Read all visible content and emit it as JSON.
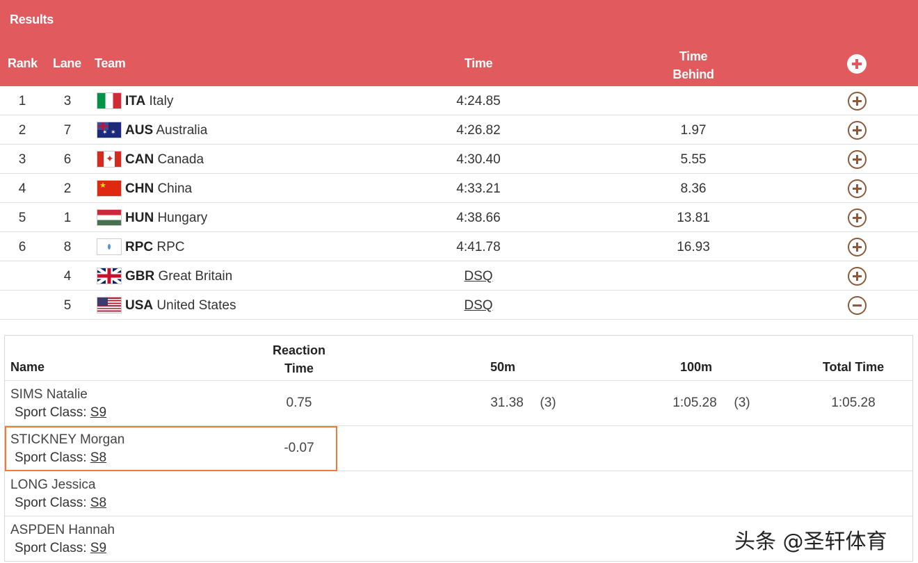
{
  "header": {
    "title": "Results",
    "columns": {
      "rank": "Rank",
      "lane": "Lane",
      "team": "Team",
      "time": "Time",
      "time_behind": "Time Behind"
    },
    "expand_all_icon": "plus-circle-filled-icon"
  },
  "results": [
    {
      "rank": "1",
      "lane": "3",
      "code": "ITA",
      "country": "Italy",
      "flag": "italy-flag-icon",
      "time": "4:24.85",
      "behind": "",
      "toggle": "plus"
    },
    {
      "rank": "2",
      "lane": "7",
      "code": "AUS",
      "country": "Australia",
      "flag": "australia-flag-icon",
      "time": "4:26.82",
      "behind": "1.97",
      "toggle": "plus"
    },
    {
      "rank": "3",
      "lane": "6",
      "code": "CAN",
      "country": "Canada",
      "flag": "canada-flag-icon",
      "time": "4:30.40",
      "behind": "5.55",
      "toggle": "plus"
    },
    {
      "rank": "4",
      "lane": "2",
      "code": "CHN",
      "country": "China",
      "flag": "china-flag-icon",
      "time": "4:33.21",
      "behind": "8.36",
      "toggle": "plus"
    },
    {
      "rank": "5",
      "lane": "1",
      "code": "HUN",
      "country": "Hungary",
      "flag": "hungary-flag-icon",
      "time": "4:38.66",
      "behind": "13.81",
      "toggle": "plus"
    },
    {
      "rank": "6",
      "lane": "8",
      "code": "RPC",
      "country": "RPC",
      "flag": "rpc-flag-icon",
      "time": "4:41.78",
      "behind": "16.93",
      "toggle": "plus"
    },
    {
      "rank": "",
      "lane": "4",
      "code": "GBR",
      "country": "Great Britain",
      "flag": "gbr-flag-icon",
      "time": "DSQ",
      "behind": "",
      "toggle": "plus"
    },
    {
      "rank": "",
      "lane": "5",
      "code": "USA",
      "country": "United States",
      "flag": "usa-flag-icon",
      "time": "DSQ",
      "behind": "",
      "toggle": "minus"
    }
  ],
  "splits": {
    "columns": {
      "name": "Name",
      "reaction_time": "Reaction Time",
      "m50": "50m",
      "m100": "100m",
      "total": "Total Time"
    },
    "sport_class_label": "Sport Class:",
    "athletes": [
      {
        "name": "SIMS Natalie",
        "sport_class": "S9",
        "reaction": "0.75",
        "m50": "31.38",
        "m50_rank": "(3)",
        "m100": "1:05.28",
        "m100_rank": "(3)",
        "total": "1:05.28"
      },
      {
        "name": "STICKNEY Morgan",
        "sport_class": "S8",
        "reaction": "-0.07",
        "m50": "",
        "m50_rank": "",
        "m100": "",
        "m100_rank": "",
        "total": "",
        "highlighted": true
      },
      {
        "name": "LONG Jessica",
        "sport_class": "S8",
        "reaction": "",
        "m50": "",
        "m50_rank": "",
        "m100": "",
        "m100_rank": "",
        "total": ""
      },
      {
        "name": "ASPDEN Hannah",
        "sport_class": "S9",
        "reaction": "",
        "m50": "",
        "m50_rank": "",
        "m100": "",
        "m100_rank": "",
        "total": ""
      }
    ]
  },
  "watermark": "头条 @圣轩体育",
  "colors": {
    "header_bg": "#e05a5e",
    "toggle_icon": "#8b5a3c",
    "highlight_border": "#f07a3a"
  }
}
